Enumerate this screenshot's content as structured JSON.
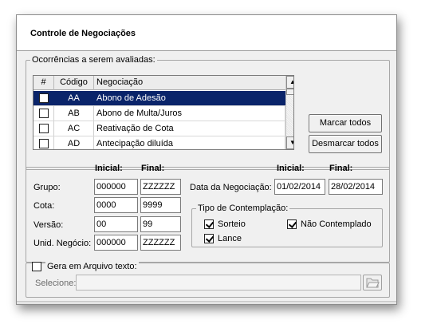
{
  "header": {
    "title": "Controle de Negociações"
  },
  "ocorrencias": {
    "legend": "Ocorrências a serem avaliadas:",
    "columns": [
      "#",
      "Código",
      "Negociação"
    ],
    "rows": [
      {
        "code": "AA",
        "name": "Abono de Adesão",
        "checked": false,
        "selected": true
      },
      {
        "code": "AB",
        "name": "Abono de Multa/Juros",
        "checked": false,
        "selected": false
      },
      {
        "code": "AC",
        "name": "Reativação de Cota",
        "checked": false,
        "selected": false
      },
      {
        "code": "AD",
        "name": "Antecipação diluída",
        "checked": false,
        "selected": false
      }
    ],
    "select_all_label": "Marcar todos",
    "deselect_all_label": "Desmarcar todos"
  },
  "filters": {
    "initial_header": "Inicial:",
    "final_header": "Final:",
    "grupo": {
      "label": "Grupo:",
      "initial": "000000",
      "final": "ZZZZZZ"
    },
    "cota": {
      "label": "Cota:",
      "initial": "0000",
      "final": "9999"
    },
    "versao": {
      "label": "Versão:",
      "initial": "00",
      "final": "99"
    },
    "unid_negocio": {
      "label": "Unid. Negócio:",
      "initial": "000000",
      "final": "ZZZZZZ"
    },
    "data_negociacao": {
      "label": "Data da Negociação:",
      "initial": "01/02/2014",
      "final": "28/02/2014"
    },
    "tipo_contemplacao": {
      "legend": "Tipo de Contemplação:",
      "sorteio": {
        "label": "Sorteio",
        "checked": true
      },
      "nao_contemplado": {
        "label": "Não Contemplado",
        "checked": true
      },
      "lance": {
        "label": "Lance",
        "checked": true
      }
    }
  },
  "arquivo": {
    "label": "Gera em Arquivo texto:",
    "checked": false,
    "select_label": "Selecione:",
    "path": "",
    "browse_icon": "folder-open-icon"
  }
}
